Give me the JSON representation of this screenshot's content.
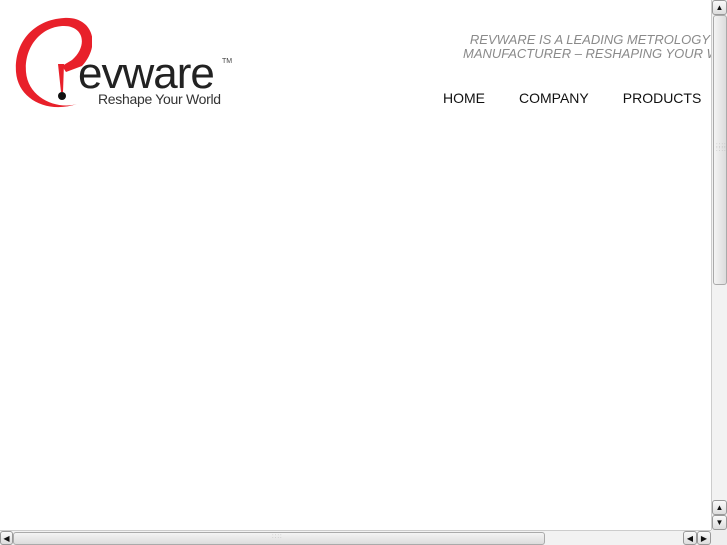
{
  "logo": {
    "word": "evware",
    "tm": "TM",
    "tagline": "Reshape Your World",
    "brand_color": "#e8202a"
  },
  "header": {
    "tagline_line1": "REVWARE IS A LEADING METROLOGY",
    "tagline_line2": "MANUFACTURER – RESHAPING YOUR WORLD"
  },
  "nav": {
    "items": [
      {
        "label": "HOME"
      },
      {
        "label": "COMPANY"
      },
      {
        "label": "PRODUCTS"
      }
    ]
  },
  "scrollbars": {
    "up_icon": "▲",
    "down_icon": "▼",
    "left_icon": "◀",
    "right_icon": "▶"
  }
}
